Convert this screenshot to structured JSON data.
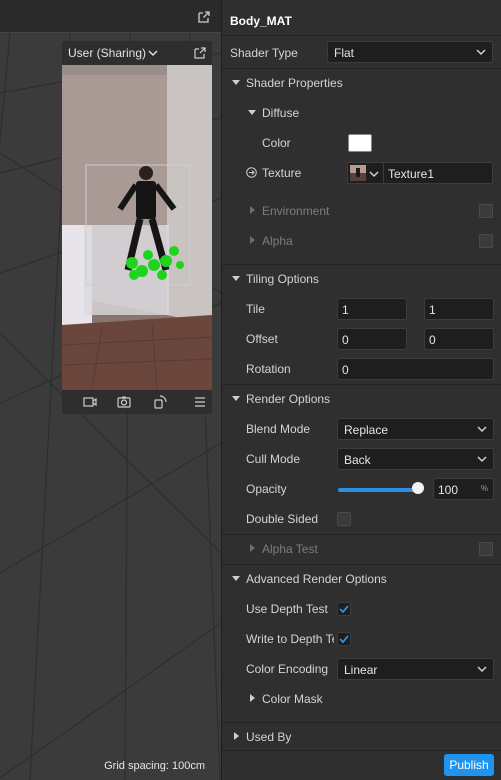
{
  "viewport": {
    "grid_spacing_label": "Grid spacing: 100cm",
    "preview": {
      "title": "User (Sharing)"
    }
  },
  "inspector": {
    "title": "Body_MAT",
    "shader_type": {
      "label": "Shader Type",
      "value": "Flat"
    },
    "shader_properties": {
      "label": "Shader Properties",
      "diffuse": {
        "label": "Diffuse",
        "color_label": "Color",
        "color_value": "#ffffff",
        "texture_label": "Texture",
        "texture_value": "Texture1"
      },
      "environment_label": "Environment",
      "alpha_label": "Alpha"
    },
    "tiling_options": {
      "label": "Tiling Options",
      "tile_label": "Tile",
      "tile_x": "1",
      "tile_y": "1",
      "offset_label": "Offset",
      "offset_x": "0",
      "offset_y": "0",
      "rotation_label": "Rotation",
      "rotation_value": "0"
    },
    "render_options": {
      "label": "Render Options",
      "blend_mode_label": "Blend Mode",
      "blend_mode_value": "Replace",
      "cull_mode_label": "Cull Mode",
      "cull_mode_value": "Back",
      "opacity_label": "Opacity",
      "opacity_value": "100",
      "opacity_unit": "%",
      "double_sided_label": "Double Sided",
      "alpha_test_label": "Alpha Test"
    },
    "advanced_render_options": {
      "label": "Advanced Render Options",
      "use_depth_test_label": "Use Depth Test",
      "write_depth_label": "Write to Depth Tel",
      "color_encoding_label": "Color Encoding",
      "color_encoding_value": "Linear",
      "color_mask_label": "Color Mask"
    },
    "used_by_label": "Used By",
    "publish_label": "Publish"
  },
  "colors": {
    "accent": "#1e93f0",
    "checkbox_tick": "#2d8fe0"
  }
}
